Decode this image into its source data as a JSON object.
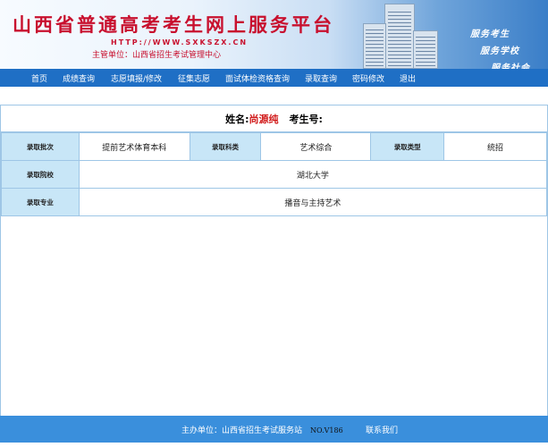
{
  "banner": {
    "title": "山西省普通高考考生网上服务平台",
    "url": "HTTP://WWW.SXKSZX.CN",
    "sponsor": "主管单位：山西省招生考试管理中心",
    "slogans": [
      "服务考生",
      "服务学校",
      "服务社会"
    ]
  },
  "nav": {
    "items": [
      "首页",
      "成绩查询",
      "志愿填报/修改",
      "征集志愿",
      "面试体检资格查询",
      "录取查询",
      "密码修改",
      "退出"
    ]
  },
  "student": {
    "name_label": "姓名:",
    "name_value": "尚源纯",
    "exam_no_label": "考生号:",
    "exam_no_value": ""
  },
  "admission": {
    "batch_label": "录取批次",
    "batch_value": "提前艺术体育本科",
    "subject_label": "录取科类",
    "subject_value": "艺术综合",
    "type_label": "录取类型",
    "type_value": "统招",
    "college_label": "录取院校",
    "college_value": "湖北大学",
    "major_label": "录取专业",
    "major_value": "播音与主持艺术"
  },
  "footer": {
    "host": "主办单位：山西省招生考试服务站",
    "code": "NO.V186",
    "contact": "联系我们"
  },
  "colors": {
    "nav_bg": "#1f6fc5",
    "label_bg": "#c8e6f7",
    "footer_bg": "#3a8fdc",
    "title_red": "#c8102e"
  }
}
